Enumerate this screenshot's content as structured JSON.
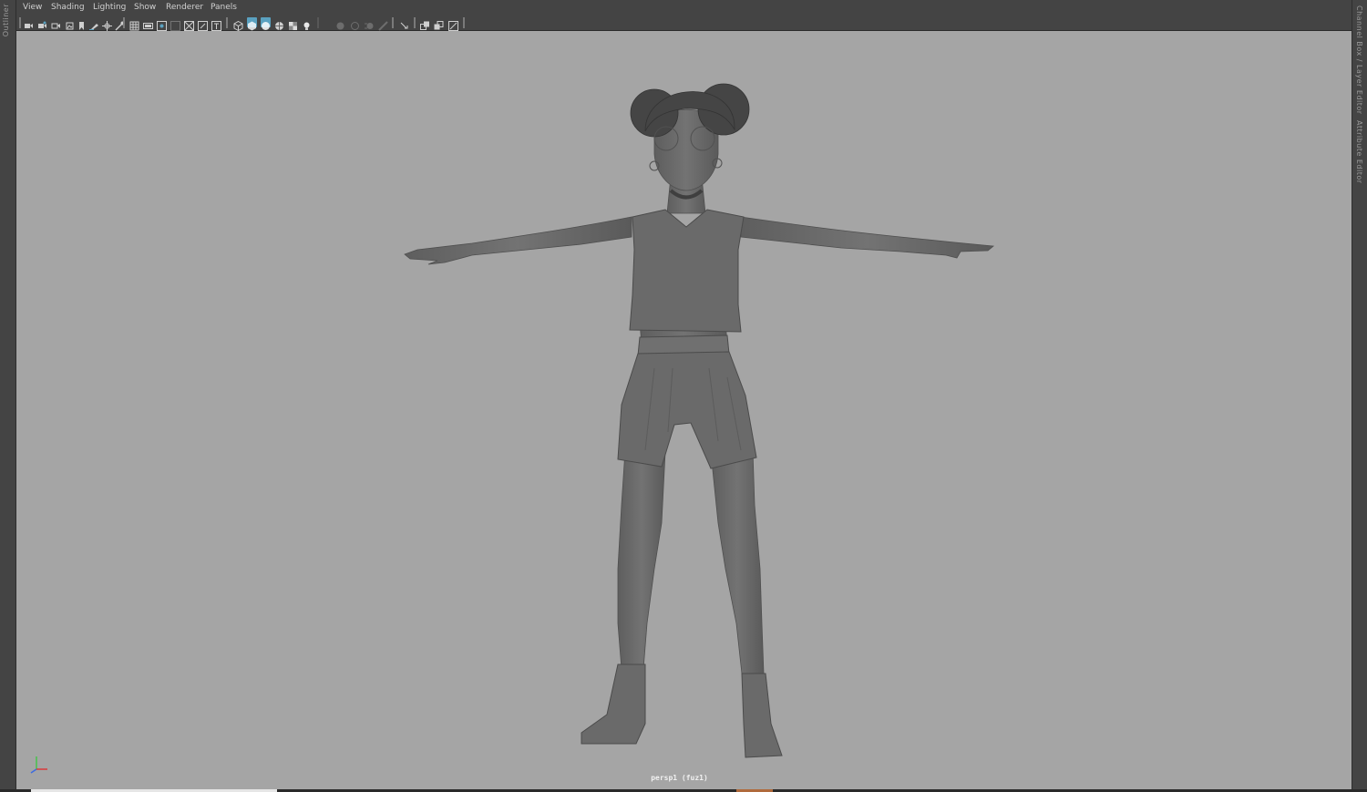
{
  "left_panel": {
    "label": "Outliner"
  },
  "right_panel": {
    "channel_box_label": "Channel Box / Layer Editor",
    "attribute_editor_label": "Attribute Editor"
  },
  "menubar": {
    "items": [
      "View",
      "Shading",
      "Lighting",
      "Show",
      "Renderer",
      "Panels"
    ]
  },
  "toolbar": {
    "icons": [
      "select-camera-icon",
      "camera-attributes-icon",
      "bookmark-camera-icon",
      "image-plane-icon",
      "bookmark-icon",
      "grease-pencil-icon",
      "2d-pan-zoom-icon",
      "camera-tool-icon",
      "grid-icon",
      "film-gate-icon",
      "resolution-gate-icon",
      "gate-mask-icon",
      "field-chart-icon",
      "safe-action-icon",
      "safe-title-icon",
      "wireframe-icon",
      "smooth-shade-icon",
      "default-material-icon",
      "wireframe-on-shaded-icon",
      "textured-icon",
      "use-lights-icon",
      "shadows-icon",
      "screen-space-ao-icon",
      "motion-blur-icon",
      "anti-aliasing-icon",
      "depth-of-field-icon",
      "isolate-select-icon",
      "xray-icon",
      "xray-joints-icon",
      "backface-culling-icon"
    ],
    "active_icons": [
      "smooth-shade-icon",
      "default-material-icon"
    ]
  },
  "viewport": {
    "camera_label": "persp1 (fuz1)",
    "background": "#a5a5a5",
    "model_color": "#6b6b6b"
  },
  "colors": {
    "accent": "#5aa1c0",
    "panel_bg": "#444444",
    "text": "#d0d0d0"
  }
}
